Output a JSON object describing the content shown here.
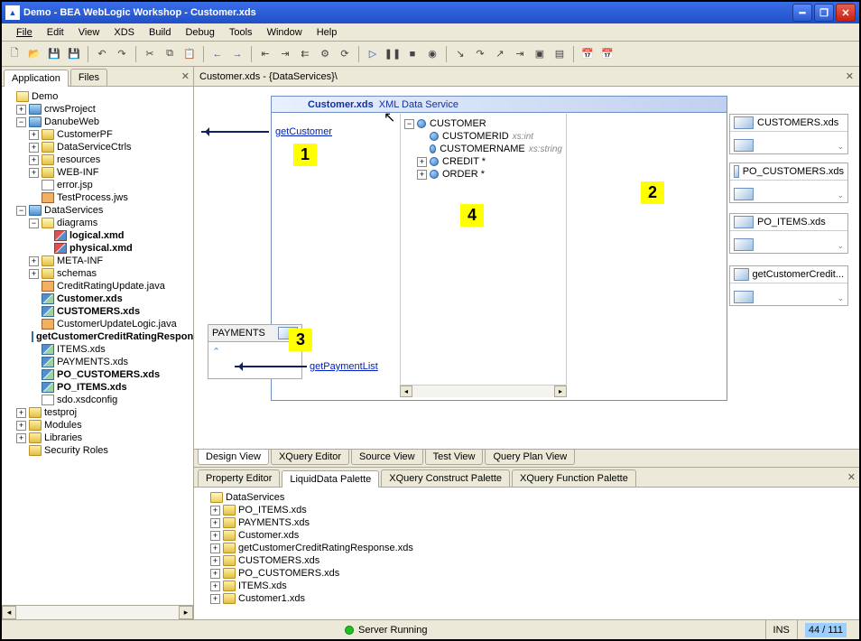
{
  "window": {
    "title": "Demo - BEA WebLogic Workshop - Customer.xds"
  },
  "menus": [
    "File",
    "Edit",
    "View",
    "XDS",
    "Build",
    "Debug",
    "Tools",
    "Window",
    "Help"
  ],
  "app_tabs": {
    "application": "Application",
    "files": "Files"
  },
  "tree": {
    "root": "Demo",
    "crws": "crwsProject",
    "danube": "DanubeWeb",
    "customerpf": "CustomerPF",
    "dsctrls": "DataServiceCtrls",
    "resources": "resources",
    "webinf": "WEB-INF",
    "errorjsp": "error.jsp",
    "testproc": "TestProcess.jws",
    "dataservices": "DataServices",
    "diagrams": "diagrams",
    "logical": "logical.xmd",
    "physical": "physical.xmd",
    "metainf": "META-INF",
    "schemas": "schemas",
    "creditupdate": "CreditRatingUpdate.java",
    "customer": "Customer.xds",
    "customers": "CUSTOMERS.xds",
    "custupdate": "CustomerUpdateLogic.java",
    "getcredit": "getCustomerCreditRatingResponse.xds",
    "items": "ITEMS.xds",
    "payments": "PAYMENTS.xds",
    "pocustomers": "PO_CUSTOMERS.xds",
    "poitems": "PO_ITEMS.xds",
    "sdo": "sdo.xsdconfig",
    "testproj": "testproj",
    "modules": "Modules",
    "libraries": "Libraries",
    "security": "Security Roles"
  },
  "editor": {
    "header": "Customer.xds - {DataServices}\\",
    "ds_title_bold": "Customer.xds",
    "ds_title_rest": "XML Data Service",
    "getCustomer": "getCustomer",
    "payments_label": "PAYMENTS",
    "getPaymentList": "getPaymentList",
    "schema": {
      "root": "CUSTOMER",
      "custid": "CUSTOMERID",
      "custid_t": "xs:int",
      "custname": "CUSTOMERNAME",
      "custname_t": "xs:string",
      "credit": "CREDIT *",
      "order": "ORDER *"
    },
    "ext1": "CUSTOMERS.xds",
    "ext2": "PO_CUSTOMERS.xds",
    "ext3": "PO_ITEMS.xds",
    "ext4": "getCustomerCredit..."
  },
  "editor_tabs": [
    "Design View",
    "XQuery Editor",
    "Source View",
    "Test View",
    "Query Plan View"
  ],
  "callouts": {
    "c1": "1",
    "c2": "2",
    "c3": "3",
    "c4": "4"
  },
  "bottom_tabs": [
    "Property Editor",
    "LiquidData Palette",
    "XQuery Construct Palette",
    "XQuery Function Palette"
  ],
  "palette": {
    "root": "DataServices",
    "items": [
      "PO_ITEMS.xds",
      "PAYMENTS.xds",
      "Customer.xds",
      "getCustomerCreditRatingResponse.xds",
      "CUSTOMERS.xds",
      "PO_CUSTOMERS.xds",
      "ITEMS.xds",
      "Customer1.xds"
    ]
  },
  "status": {
    "server": "Server Running",
    "ins": "INS",
    "pos": "44 / 111"
  }
}
